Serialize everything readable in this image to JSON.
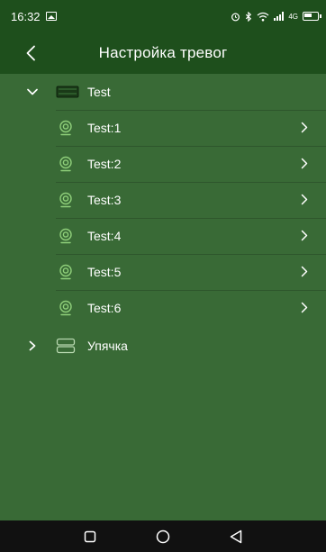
{
  "status_bar": {
    "time": "16:32",
    "net_tag": "4G",
    "icons": [
      "image-icon",
      "alarm-clock-icon",
      "bluetooth-icon",
      "wifi-icon",
      "signal-icon",
      "battery-icon"
    ]
  },
  "header": {
    "title": "Настройка тревог",
    "back_icon": "back-arrow-icon"
  },
  "groups": [
    {
      "label": "Test",
      "expanded": true,
      "icon": "nvr-device-icon",
      "cameras": [
        {
          "label": "Test:1"
        },
        {
          "label": "Test:2"
        },
        {
          "label": "Test:3"
        },
        {
          "label": "Test:4"
        },
        {
          "label": "Test:5"
        },
        {
          "label": "Test:6"
        }
      ]
    },
    {
      "label": "Упячка",
      "expanded": false,
      "icon": "server-device-icon"
    }
  ],
  "colors": {
    "bar_background": "#1e4f1c",
    "content_background": "#396a36",
    "camera_icon": "#8fcf7a",
    "nav_bar": "#111111"
  },
  "nav_bar": {
    "icons": [
      "recent-apps-icon",
      "home-icon",
      "back-icon"
    ]
  }
}
